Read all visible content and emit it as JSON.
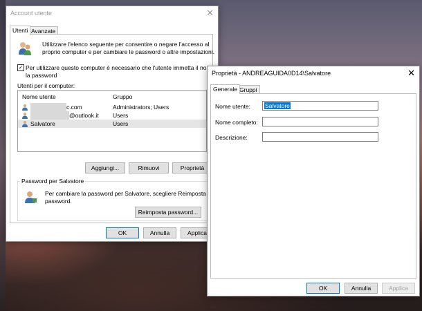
{
  "account_window": {
    "title": "Account utente",
    "tabs": [
      "Utenti",
      "Avanzate"
    ],
    "intro_text_line1": "Utilizzare l'elenco seguente per consentire o negare l'accesso al",
    "intro_text_line2": "proprio computer e per cambiare le password o altre impostazioni.",
    "checkbox_label_line1": "Per utilizzare questo computer è necessario che l'utente immetta il nome e",
    "checkbox_label_line2": "la password",
    "users_label": "Utenti per il computer:",
    "columns": [
      "Nome utente",
      "Gruppo"
    ],
    "rows": [
      {
        "name": "c.com",
        "group": "Administrators; Users"
      },
      {
        "name": "@outlook.it",
        "group": "Users"
      },
      {
        "name": "Salvatore",
        "group": "Users"
      }
    ],
    "buttons": {
      "add": "Aggiungi...",
      "remove": "Rimuovi",
      "properties": "Proprietà"
    },
    "password_group_title": "Password per Salvatore",
    "password_text_line1": "Per cambiare la password per Salvatore, scegliere Reimposta",
    "password_text_line2": "password.",
    "reset_button": "Reimposta password...",
    "footer_buttons": {
      "ok": "OK",
      "cancel": "Annulla",
      "apply": "Applica"
    }
  },
  "properties_window": {
    "title": "Proprietà - ANDREAGUIDA0D14\\Salvatore",
    "tabs": [
      "Generale",
      "Gruppi"
    ],
    "fields": {
      "username_label": "Nome utente:",
      "username_value": "Salvatore",
      "fullname_label": "Nome completo:",
      "fullname_value": "",
      "description_label": "Descrizione:",
      "description_value": ""
    },
    "footer_buttons": {
      "ok": "OK",
      "cancel": "Annulla",
      "apply": "Applica"
    }
  },
  "colors": {
    "accent": "#0078d7",
    "selection": "#e5e5e5",
    "highlight_text_bg": "#0078d7"
  }
}
